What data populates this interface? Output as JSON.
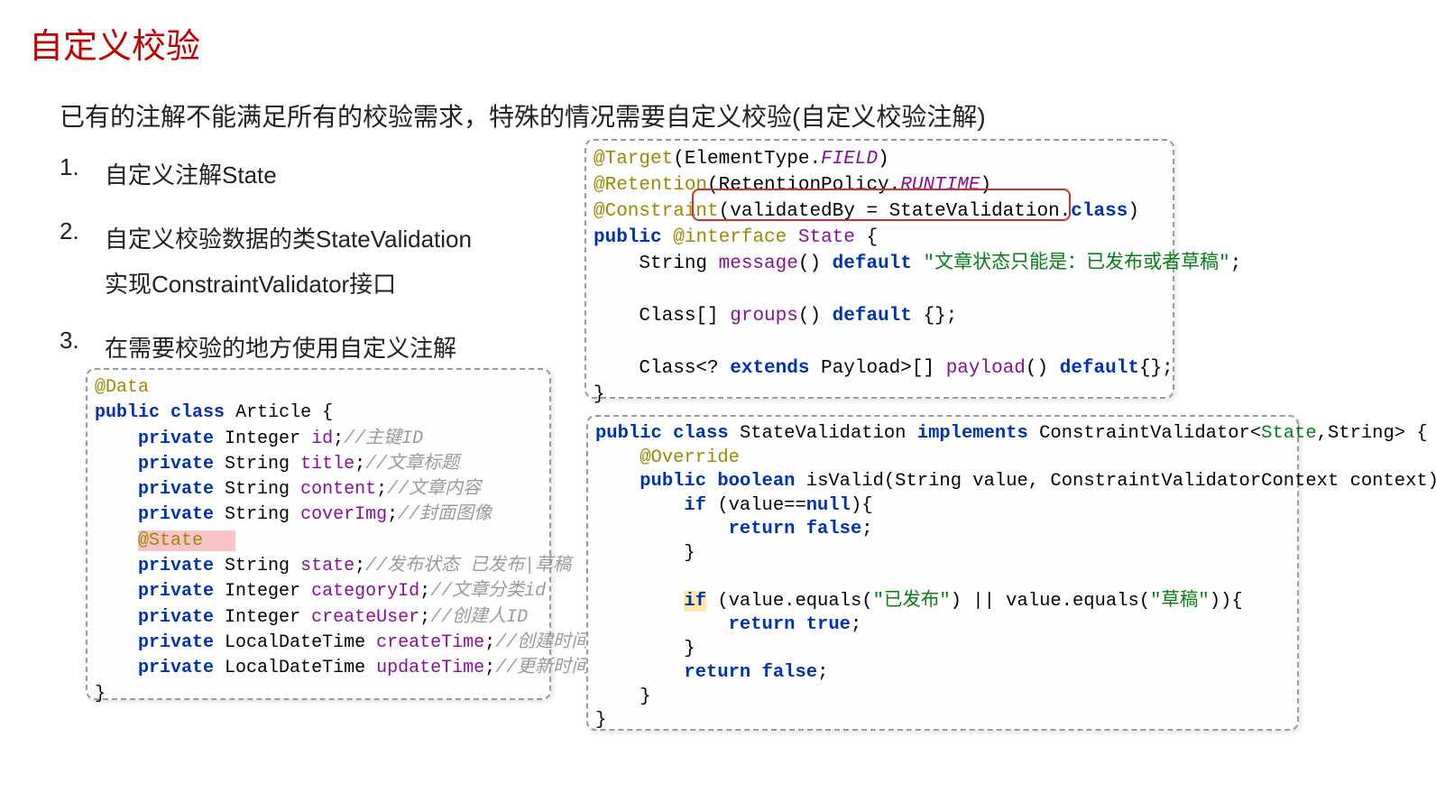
{
  "title": "自定义校验",
  "subtitle": "已有的注解不能满足所有的校验需求，特殊的情况需要自定义校验(自定义校验注解)",
  "list": [
    {
      "num": "1.",
      "text": "自定义注解State"
    },
    {
      "num": "2.",
      "text": "自定义校验数据的类StateValidation\n实现ConstraintValidator接口"
    },
    {
      "num": "3.",
      "text": "在需要校验的地方使用自定义注解"
    }
  ],
  "code_article": {
    "annotation": "@Data",
    "decl": [
      "public",
      "class",
      "Article {"
    ],
    "fields": [
      {
        "mod": "private",
        "type": "Integer",
        "name": "id",
        "comment": "//主键ID"
      },
      {
        "mod": "private",
        "type": "String",
        "name": "title",
        "comment": "//文章标题"
      },
      {
        "mod": "private",
        "type": "String",
        "name": "content",
        "comment": "//文章内容"
      },
      {
        "mod": "private",
        "type": "String",
        "name": "coverImg",
        "comment": "//封面图像"
      },
      {
        "state_annotation": "@State"
      },
      {
        "mod": "private",
        "type": "String",
        "name": "state",
        "comment": "//发布状态 已发布|草稿"
      },
      {
        "mod": "private",
        "type": "Integer",
        "name": "categoryId",
        "comment": "//文章分类id"
      },
      {
        "mod": "private",
        "type": "Integer",
        "name": "createUser",
        "comment": "//创建人ID"
      },
      {
        "mod": "private",
        "type": "LocalDateTime",
        "name": "createTime",
        "comment": "//创建时间"
      },
      {
        "mod": "private",
        "type": "LocalDateTime",
        "name": "updateTime",
        "comment": "//更新时间"
      }
    ],
    "close": "}"
  },
  "code_state": {
    "l1": {
      "ann": "@Target",
      "open": "(ElementType.",
      "field": "FIELD",
      "close": ")"
    },
    "l2": {
      "ann": "@Retention",
      "open": "(RetentionPolicy.",
      "field": "RUNTIME",
      "close": ")"
    },
    "l3": {
      "ann": "@Constraint",
      "args": "(validatedBy = StateValidation.",
      "cls": "class",
      "close": ")"
    },
    "l4": {
      "pub": "public",
      "at": "@interface",
      "name": "State",
      "brace": " {"
    },
    "l5": {
      "pre": "    String ",
      "m": "message",
      "p": "() ",
      "def": "default",
      "sp": " ",
      "str": "\"文章状态只能是：已发布或者草稿\"",
      "semi": ";"
    },
    "l6": "",
    "l7": {
      "pre": "    Class[] ",
      "m": "groups",
      "p": "() ",
      "def": "default",
      "rest": " {};"
    },
    "l8": "",
    "l9": {
      "pre": "    Class<? ",
      "ext": "extends",
      "mid": " Payload>[] ",
      "m": "payload",
      "p": "() ",
      "def": "default",
      "rest": "{};"
    },
    "l10": "}"
  },
  "code_valid": {
    "l1": {
      "pub": "public",
      "sp1": " ",
      "cls": "class",
      "name": " StateValidation ",
      "impl": "implements",
      "mid": " ConstraintValidator<",
      "tp": "State",
      "rest": ",String> {"
    },
    "l2": {
      "pad": "    ",
      "ann": "@Override"
    },
    "l3": {
      "pad": "    ",
      "pub": "public",
      "sp": " ",
      "bool": "boolean",
      "rest": " isValid(String value, ConstraintValidatorContext context) {"
    },
    "l4": {
      "pad": "        ",
      "if": "if",
      "rest": " (value==",
      "nul": "null",
      "close": "){"
    },
    "l5": {
      "pad": "            ",
      "ret": "return",
      "sp": " ",
      "val": "false",
      "semi": ";"
    },
    "l6": {
      "pad": "        ",
      "close": "}"
    },
    "l7": "",
    "l8": {
      "pad": "        ",
      "if": "if",
      "open": " (value.equals(",
      "s1": "\"已发布\"",
      "mid": ") || value.equals(",
      "s2": "\"草稿\"",
      "close": ")){"
    },
    "l9": {
      "pad": "            ",
      "ret": "return",
      "sp": " ",
      "val": "true",
      "semi": ";"
    },
    "l10": {
      "pad": "        ",
      "close": "}"
    },
    "l11": {
      "pad": "        ",
      "ret": "return",
      "sp": " ",
      "val": "false",
      "semi": ";"
    },
    "l12": {
      "pad": "    ",
      "close": "}"
    },
    "l13": "}"
  }
}
